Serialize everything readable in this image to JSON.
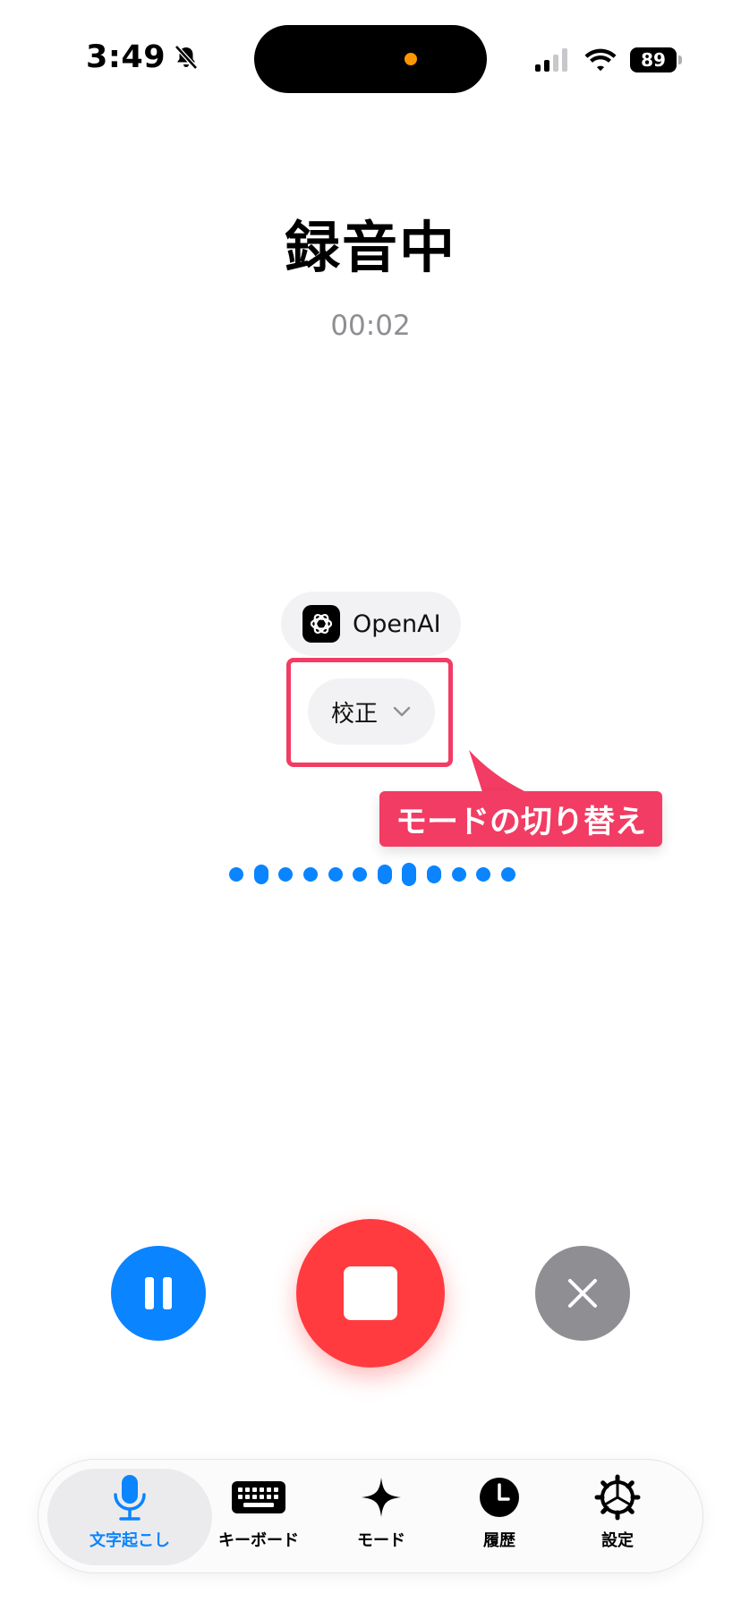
{
  "status_bar": {
    "time": "3:49",
    "battery": "89"
  },
  "recording": {
    "title": "録音中",
    "timer": "00:02"
  },
  "provider": {
    "name": "OpenAI"
  },
  "mode_selector": {
    "label": "校正"
  },
  "callout": {
    "text": "モードの切り替え"
  },
  "tabs": [
    {
      "label": "文字起こし",
      "icon": "microphone-icon",
      "active": true
    },
    {
      "label": "キーボード",
      "icon": "keyboard-icon",
      "active": false
    },
    {
      "label": "モード",
      "icon": "sparkle-icon",
      "active": false
    },
    {
      "label": "履歴",
      "icon": "clock-icon",
      "active": false
    },
    {
      "label": "設定",
      "icon": "gear-icon",
      "active": false
    }
  ],
  "colors": {
    "accent": "#0a84ff",
    "record": "#ff3b3f",
    "cancel": "#8e8e93",
    "highlight": "#f23c63"
  }
}
